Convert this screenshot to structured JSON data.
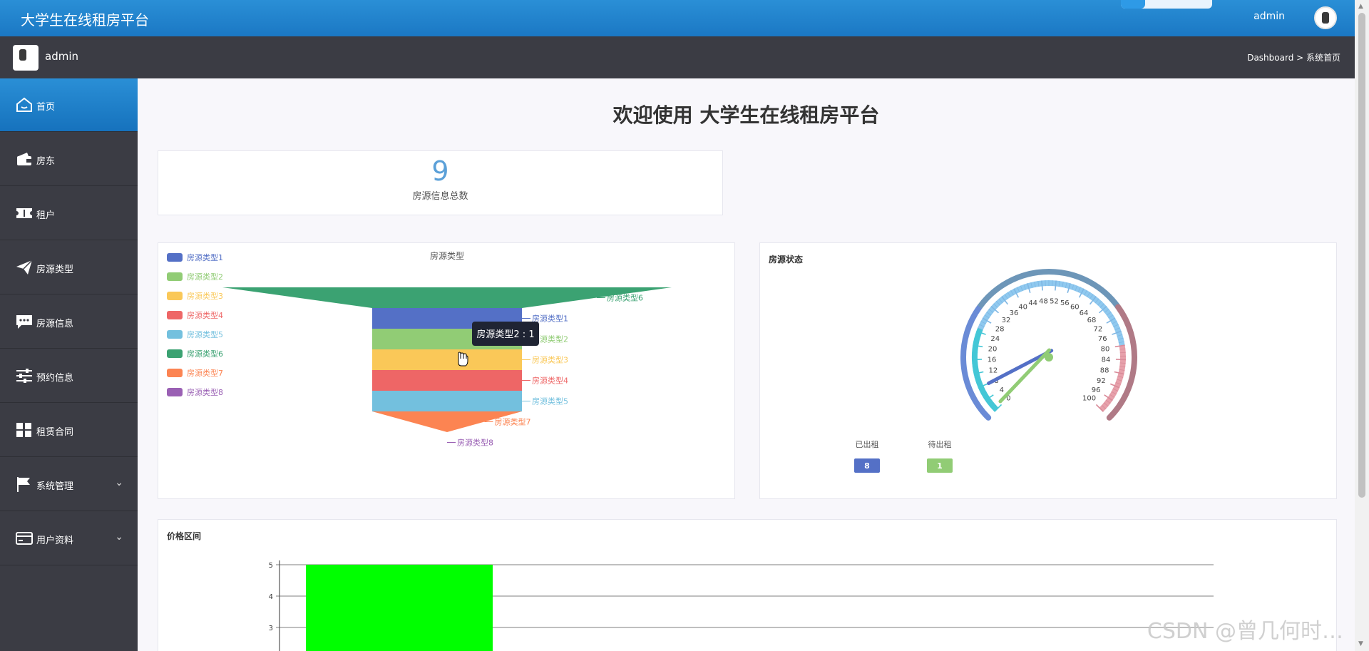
{
  "header": {
    "app_title": "大学生在线租房平台",
    "user": "admin"
  },
  "subbar": {
    "user": "admin",
    "breadcrumb": "Dashboard > 系统首页"
  },
  "sidebar": {
    "items": [
      {
        "label": "首页",
        "icon": "home-icon",
        "active": true
      },
      {
        "label": "房东",
        "icon": "wallet-icon"
      },
      {
        "label": "租户",
        "icon": "ticket-icon"
      },
      {
        "label": "房源类型",
        "icon": "paper-plane-icon"
      },
      {
        "label": "房源信息",
        "icon": "message-icon"
      },
      {
        "label": "预约信息",
        "icon": "sliders-icon"
      },
      {
        "label": "租赁合同",
        "icon": "grid-icon"
      },
      {
        "label": "系统管理",
        "icon": "flag-icon",
        "expandable": true
      },
      {
        "label": "用户资料",
        "icon": "card-icon",
        "expandable": true
      }
    ]
  },
  "main": {
    "welcome": "欢迎使用 大学生在线租房平台",
    "count": {
      "value": "9",
      "label": "房源信息总数"
    }
  },
  "funnel": {
    "title": "房源类型",
    "tooltip": "房源类型2 : 1",
    "legend": [
      "房源类型1",
      "房源类型2",
      "房源类型3",
      "房源类型4",
      "房源类型5",
      "房源类型6",
      "房源类型7",
      "房源类型8"
    ],
    "colors": [
      "#5470c6",
      "#91cc75",
      "#fac858",
      "#ee6666",
      "#73c0de",
      "#3ba272",
      "#fc8452",
      "#9a60b4"
    ]
  },
  "gauge": {
    "title": "房源状态",
    "ticks": [
      "0",
      "4",
      "8",
      "12",
      "16",
      "20",
      "24",
      "28",
      "32",
      "36",
      "40",
      "44",
      "48",
      "52",
      "56",
      "60",
      "64",
      "68",
      "72",
      "76",
      "80",
      "84",
      "88",
      "92",
      "96",
      "100"
    ],
    "legend": [
      {
        "label": "已出租",
        "value": "8",
        "color": "#5470c6"
      },
      {
        "label": "待出租",
        "value": "1",
        "color": "#91cc75"
      }
    ]
  },
  "price": {
    "title": "价格区间"
  },
  "chart_data": [
    {
      "type": "funnel",
      "title": "房源类型",
      "categories": [
        "房源类型1",
        "房源类型2",
        "房源类型3",
        "房源类型4",
        "房源类型5",
        "房源类型6",
        "房源类型7",
        "房源类型8"
      ],
      "values": [
        1,
        1,
        1,
        1,
        1,
        3,
        1,
        0
      ],
      "legend_position": "left"
    },
    {
      "type": "gauge",
      "title": "房源状态",
      "series": [
        {
          "name": "已出租",
          "value": 8
        },
        {
          "name": "待出租",
          "value": 1
        }
      ],
      "ylim": [
        0,
        100
      ]
    },
    {
      "type": "bar",
      "title": "价格区间",
      "ylim": [
        0,
        5
      ],
      "yticks": [
        "3",
        "4",
        "5"
      ],
      "values": [
        5
      ],
      "color": "#00ff00",
      "grid": true
    }
  ],
  "watermark": "CSDN @曾几何时…"
}
